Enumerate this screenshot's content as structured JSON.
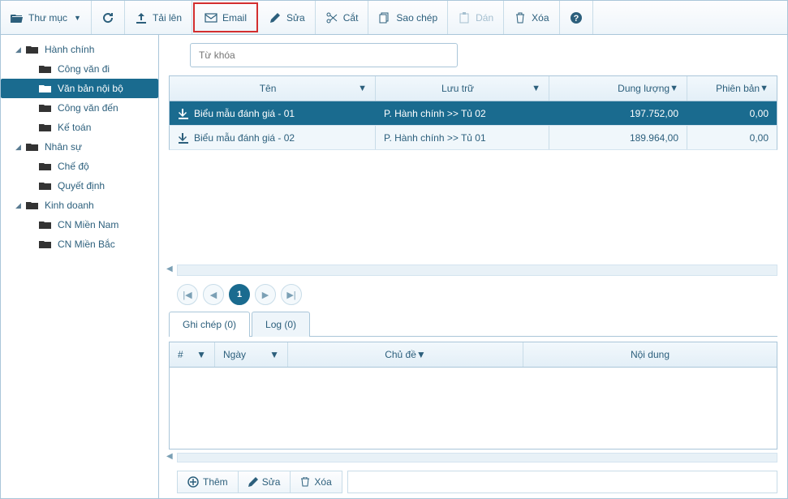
{
  "toolbar": {
    "folder": "Thư mục",
    "upload": "Tải lên",
    "email": "Email",
    "edit": "Sửa",
    "cut": "Cắt",
    "copy": "Sao chép",
    "paste": "Dán",
    "delete": "Xóa"
  },
  "tree": {
    "hanh_chinh": "Hành chính",
    "cong_van_di": "Công văn đi",
    "van_ban_noi_bo": "Văn bản nội bộ",
    "cong_van_den": "Công văn đến",
    "ke_toan": "Kế toán",
    "nhan_su": "Nhân sự",
    "che_do": "Chế độ",
    "quyet_dinh": "Quyết định",
    "kinh_doanh": "Kinh doanh",
    "cn_mien_nam": "CN Miền Nam",
    "cn_mien_bac": "CN Miền Bắc"
  },
  "search": {
    "placeholder": "Từ khóa"
  },
  "grid": {
    "columns": {
      "name": "Tên",
      "store": "Lưu trữ",
      "size": "Dung lượng",
      "version": "Phiên bản"
    },
    "rows": [
      {
        "name": "Biểu mẫu đánh giá - 01",
        "store": "P. Hành chính >> Tủ 02",
        "size": "197.752,00",
        "version": "0,00"
      },
      {
        "name": "Biểu mẫu đánh giá - 02",
        "store": "P. Hành chính >> Tủ 01",
        "size": "189.964,00",
        "version": "0,00"
      }
    ]
  },
  "pager": {
    "page": "1"
  },
  "tabs": {
    "notes": "Ghi chép (0)",
    "log": "Log (0)"
  },
  "notes": {
    "columns": {
      "idx": "#",
      "date": "Ngày",
      "subject": "Chủ đề",
      "content": "Nội dung"
    }
  },
  "bottom": {
    "add": "Thêm",
    "edit": "Sửa",
    "delete": "Xóa"
  }
}
